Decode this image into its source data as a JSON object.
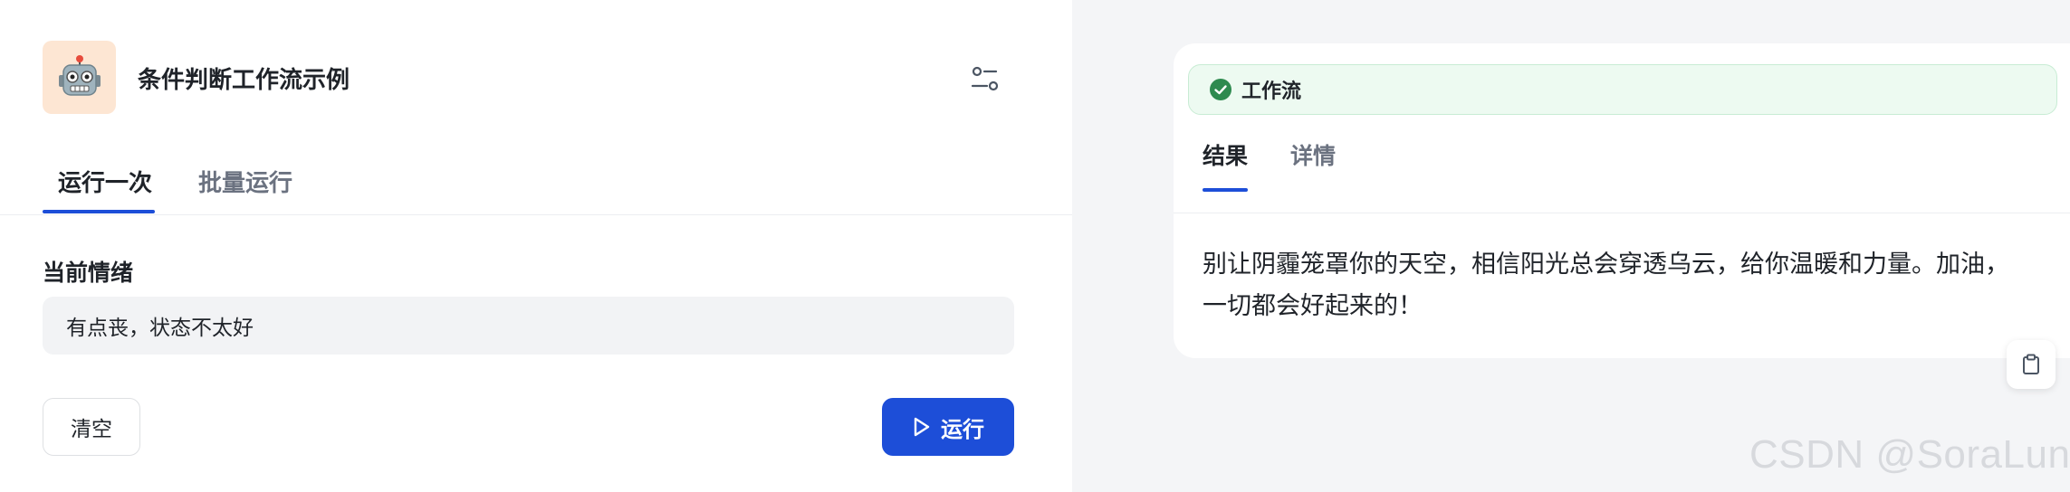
{
  "app": {
    "title": "条件判断工作流示例",
    "icon": "robot-emoji-icon"
  },
  "tabs": {
    "run_once": "运行一次",
    "batch_run": "批量运行"
  },
  "form": {
    "field_label": "当前情绪",
    "field_value": "有点丧，状态不太好"
  },
  "buttons": {
    "clear": "清空",
    "run": "运行"
  },
  "result_panel": {
    "status_label": "工作流",
    "status_color": "#2e8a4f",
    "tabs": {
      "result": "结果",
      "detail": "详情"
    },
    "output_text": "别让阴霾笼罩你的天空，相信阳光总会穿透乌云，给你温暖和力量。加油，一切都会好起来的！"
  },
  "watermark": "CSDN @SoraLuna",
  "colors": {
    "accent": "#1d4ed8",
    "success": "#2e8a4f",
    "icon_bg": "#fde6d3"
  }
}
